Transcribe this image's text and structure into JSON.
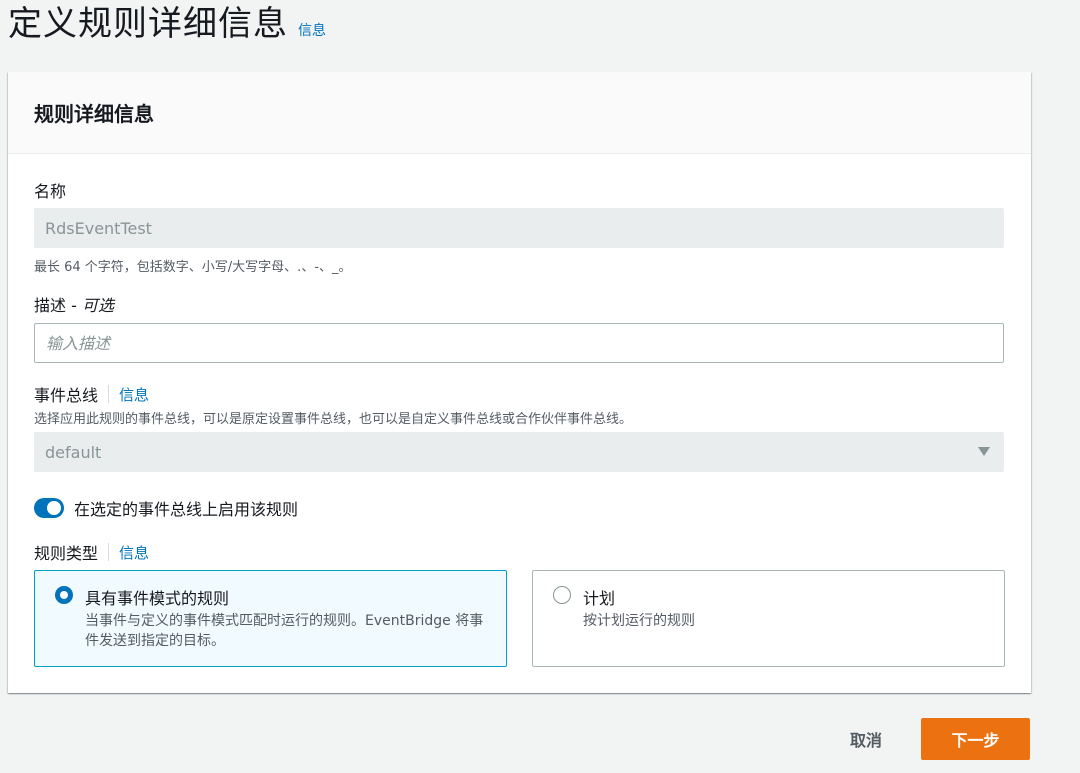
{
  "page": {
    "title": "定义规则详细信息",
    "info_link": "信息"
  },
  "panel": {
    "title": "规则详细信息"
  },
  "name_field": {
    "label": "名称",
    "value": "RdsEventTest",
    "help": "最长 64 个字符，包括数字、小写/大写字母、.、-、_。"
  },
  "description_field": {
    "label": "描述 - ",
    "label_optional": "可选",
    "placeholder": "输入描述",
    "value": ""
  },
  "event_bus": {
    "label": "事件总线",
    "info_link": "信息",
    "help": "选择应用此规则的事件总线，可以是原定设置事件总线，也可以是自定义事件总线或合作伙伴事件总线。",
    "selected": "default"
  },
  "enable_toggle": {
    "label": "在选定的事件总线上启用该规则",
    "enabled": true
  },
  "rule_type": {
    "label": "规则类型",
    "info_link": "信息",
    "options": [
      {
        "title": "具有事件模式的规则",
        "description": "当事件与定义的事件模式匹配时运行的规则。EventBridge 将事件发送到指定的目标。",
        "selected": true
      },
      {
        "title": "计划",
        "description": "按计划运行的规则",
        "selected": false
      }
    ]
  },
  "footer": {
    "cancel_label": "取消",
    "next_label": "下一步"
  },
  "colors": {
    "accent": "#0073bb",
    "primary_button": "#ec7211",
    "selected_tile_bg": "#f1faff",
    "selected_tile_border": "#00a1c9"
  }
}
